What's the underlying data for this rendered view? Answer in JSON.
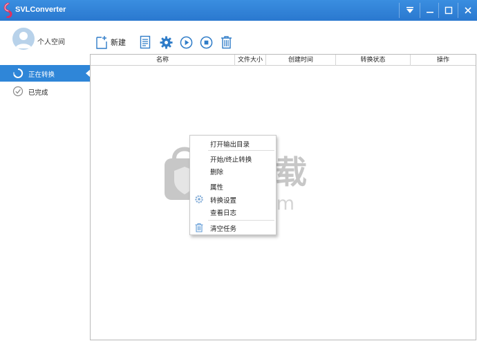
{
  "window": {
    "title": "SVLConverter",
    "accent": "#2a78cf",
    "controls": [
      "menu-icon",
      "minimize-icon",
      "maximize-icon",
      "close-icon"
    ]
  },
  "profile": {
    "label": "个人空间"
  },
  "sidebar": {
    "items": [
      {
        "label": "正在转换",
        "icon": "converting-icon",
        "active": true
      },
      {
        "label": "已完成",
        "icon": "check-circle-icon",
        "active": false
      }
    ]
  },
  "toolbar": {
    "new_label": "新建",
    "icons": [
      "new-file-icon",
      "document-list-icon",
      "gear-icon",
      "play-icon",
      "stop-icon",
      "trash-icon"
    ]
  },
  "table": {
    "columns": [
      "名称",
      "文件大小",
      "创建时间",
      "转换状态",
      "操作"
    ]
  },
  "context_menu": {
    "items": [
      {
        "label": "打开输出目录"
      },
      {
        "label": "开始/终止转换"
      },
      {
        "label": "删除"
      },
      {
        "label": "属性"
      },
      {
        "label": "转换设置"
      },
      {
        "label": "查看日志"
      },
      {
        "label": "清空任务"
      }
    ]
  },
  "watermark": {
    "text": "安下载",
    "subtext": "anxz.com"
  }
}
